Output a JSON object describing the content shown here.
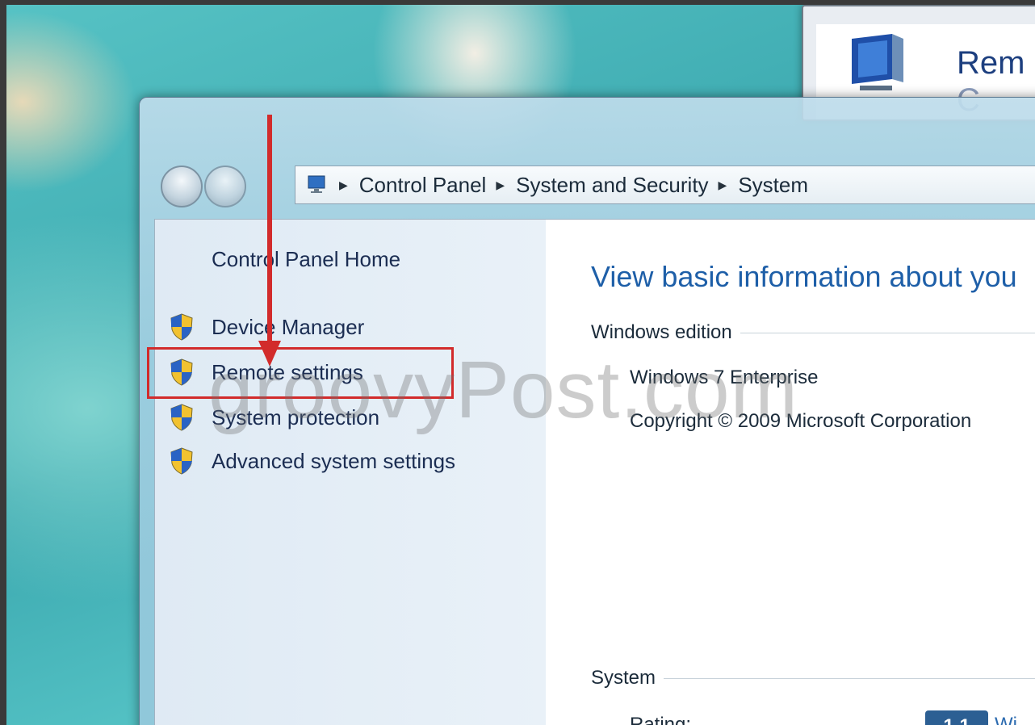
{
  "background_dialog": {
    "title": "Rem",
    "title_second_line": "C"
  },
  "window": {
    "address_bar": {
      "crumbs": [
        "Control Panel",
        "System and Security",
        "System"
      ]
    },
    "sidebar": {
      "home_link": "Control Panel Home",
      "tasks": [
        {
          "label": "Device Manager",
          "icon": "uac-shield-icon"
        },
        {
          "label": "Remote settings",
          "icon": "uac-shield-icon"
        },
        {
          "label": "System protection",
          "icon": "uac-shield-icon"
        },
        {
          "label": "Advanced system settings",
          "icon": "uac-shield-icon"
        }
      ]
    },
    "main": {
      "heading": "View basic information about you",
      "windows_edition": {
        "label": "Windows edition",
        "edition": "Windows 7 Enterprise",
        "copyright": "Copyright © 2009 Microsoft Corporation"
      },
      "system": {
        "label": "System",
        "rating_label": "Rating:",
        "rating_value": "1.1",
        "rating_link": "Wi"
      }
    }
  },
  "annotations": {
    "watermark": "groovyPost.com",
    "arrow_color": "#d22b2b",
    "highlight_color": "#d22b2b"
  }
}
